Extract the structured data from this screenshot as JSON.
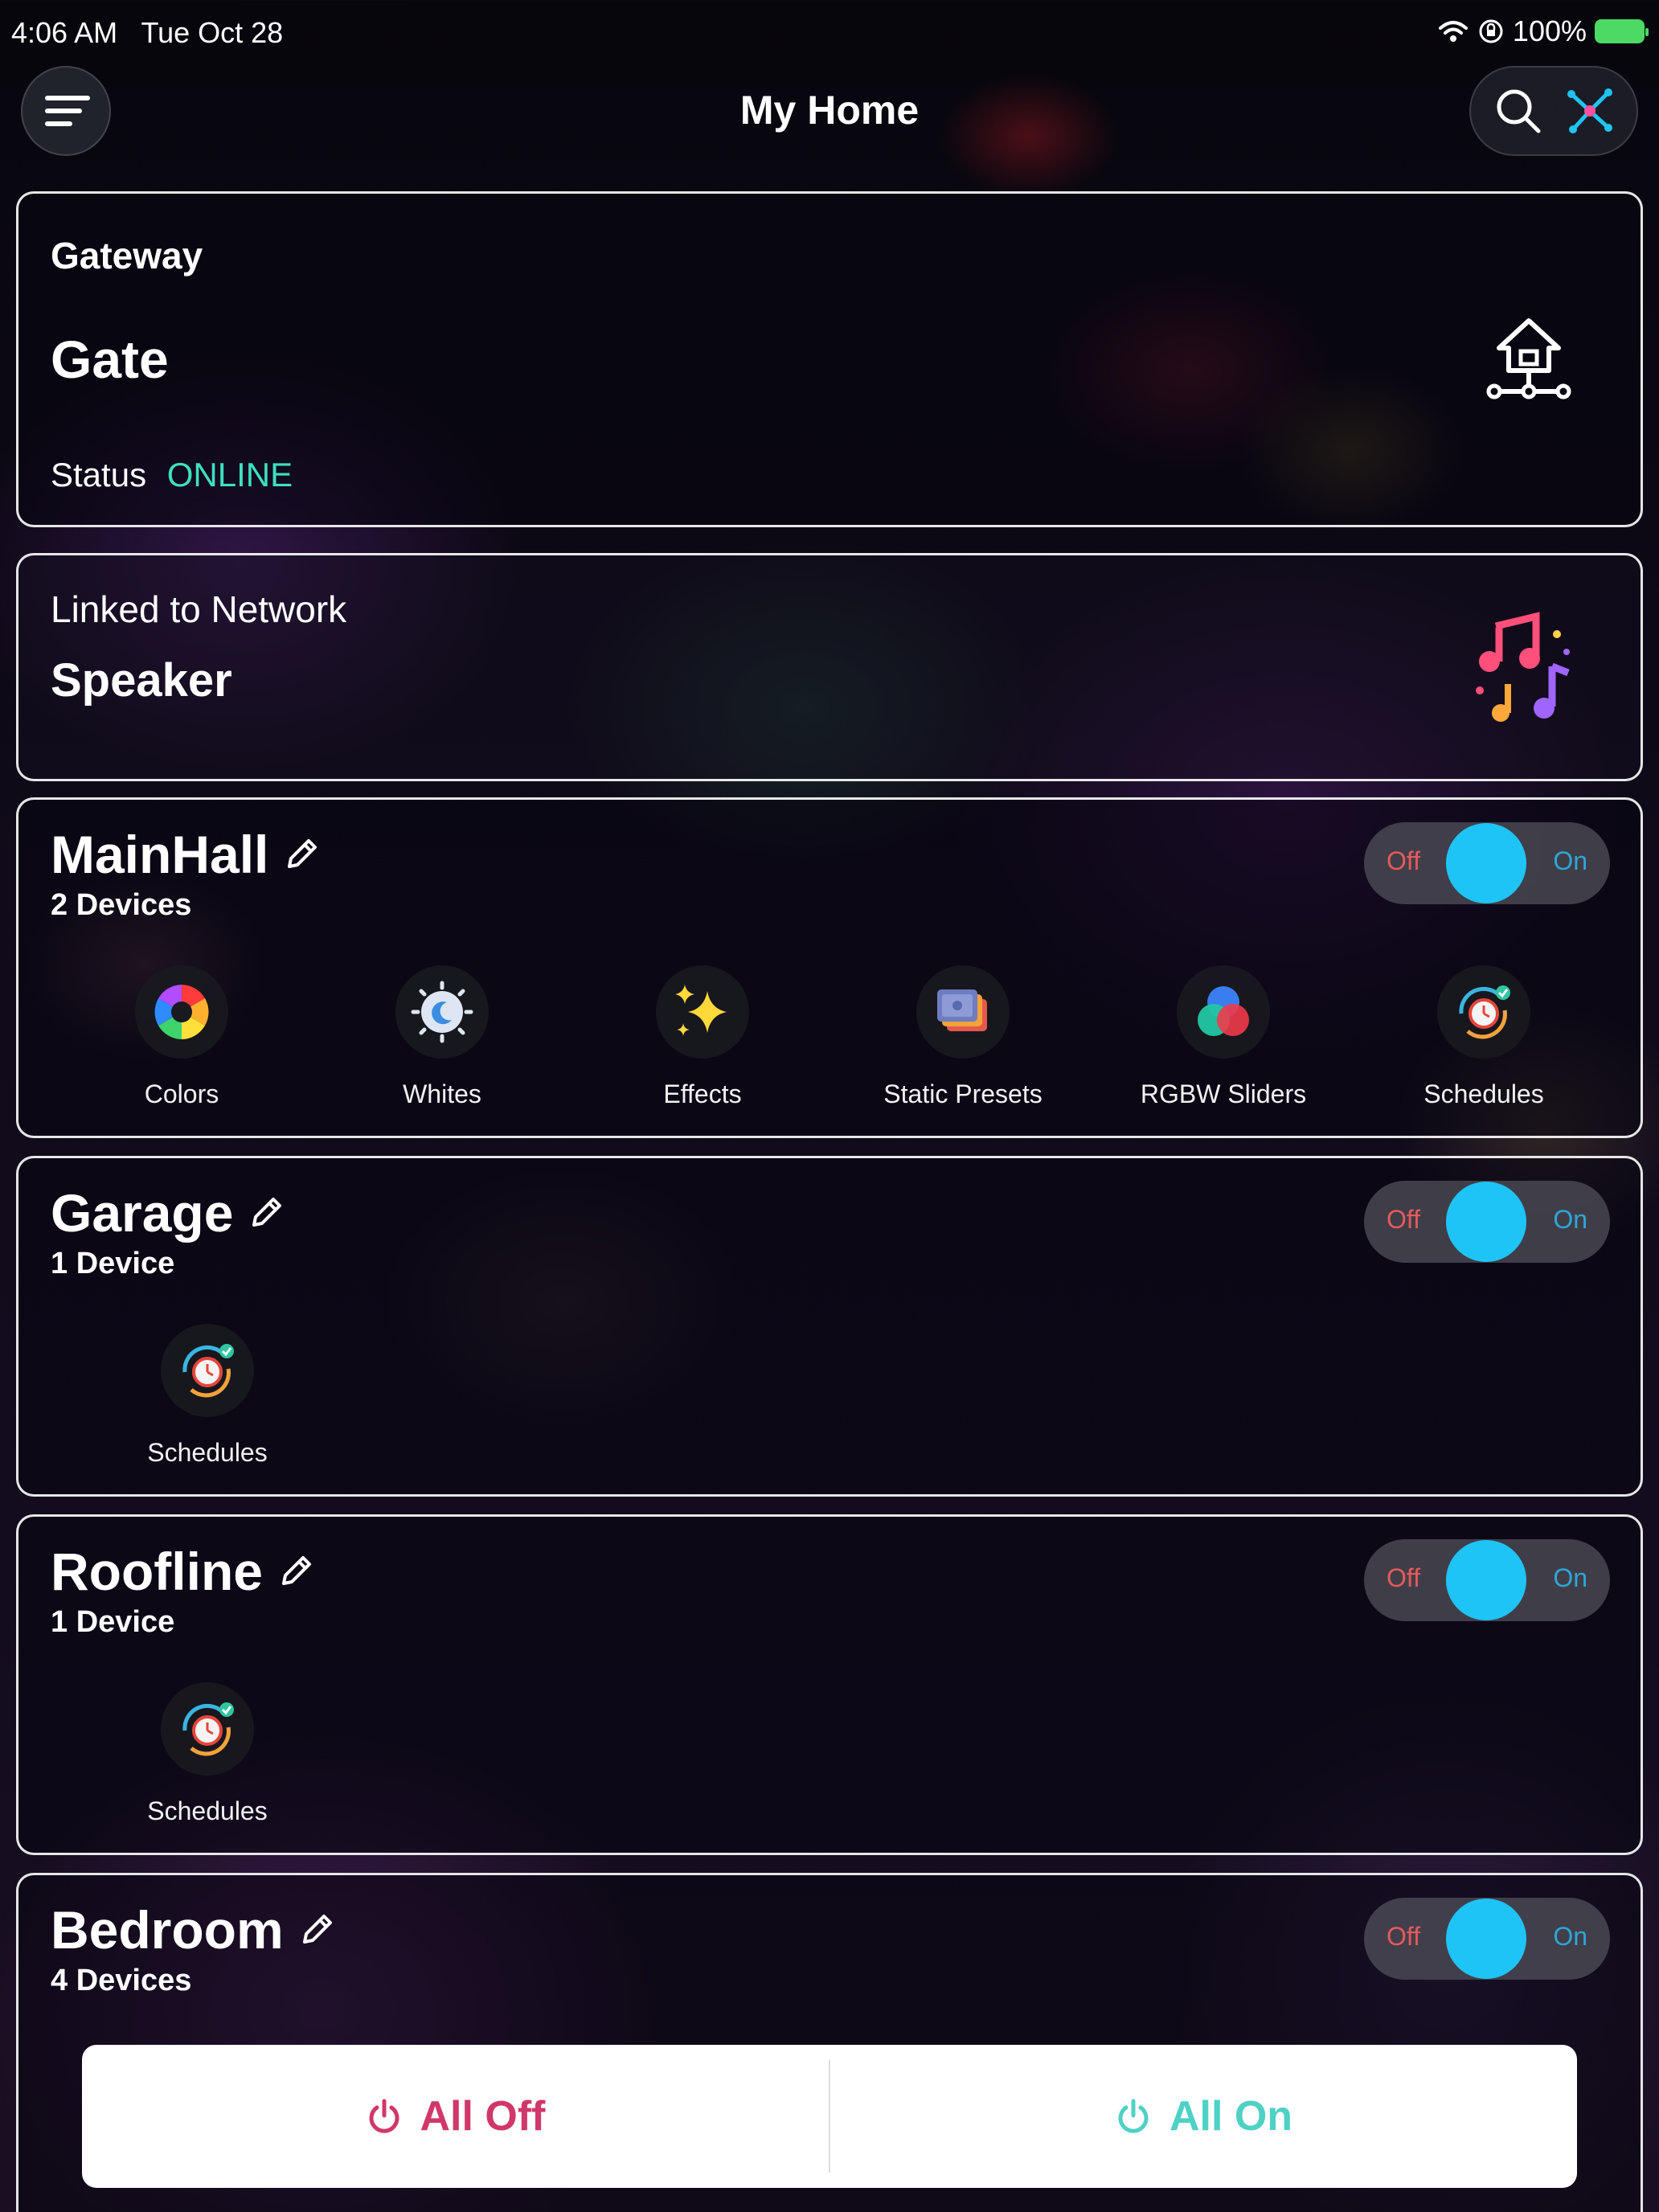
{
  "status_bar": {
    "time": "4:06 AM",
    "date": "Tue Oct 28",
    "battery": "100%"
  },
  "header": {
    "title": "My Home"
  },
  "gateway": {
    "label": "Gateway",
    "name": "Gate",
    "status_label": "Status",
    "status_value": "ONLINE"
  },
  "speaker": {
    "label": "Linked to Network",
    "name": "Speaker"
  },
  "rooms": [
    {
      "name": "MainHall",
      "count": "2 Devices",
      "off": "Off",
      "on": "On",
      "state": "on",
      "features": [
        "Colors",
        "Whites",
        "Effects",
        "Static Presets",
        "RGBW Sliders",
        "Schedules"
      ]
    },
    {
      "name": "Garage",
      "count": "1 Device",
      "off": "Off",
      "on": "On",
      "state": "on",
      "features": [
        "Schedules"
      ]
    },
    {
      "name": "Roofline",
      "count": "1 Device",
      "off": "Off",
      "on": "On",
      "state": "on",
      "features": [
        "Schedules"
      ]
    },
    {
      "name": "Bedroom",
      "count": "4 Devices",
      "off": "Off",
      "on": "On",
      "state": "on",
      "features": []
    }
  ],
  "bottom": {
    "all_off": "All Off",
    "all_on": "All On"
  },
  "colors": {
    "accent": "#1ec4f5",
    "online": "#3ee0c0",
    "off_red": "#d0386a",
    "on_teal": "#4fd1c5"
  },
  "icons": {
    "menu": "hamburger-icon",
    "search": "search-icon",
    "network": "network-icon",
    "gateway": "home-network-icon",
    "speaker": "music-notes-icon",
    "edit": "pencil-icon",
    "colors": "color-wheel-icon",
    "whites": "sun-moon-icon",
    "effects": "sparkles-icon",
    "static_presets": "presets-stack-icon",
    "rgbw": "rgb-circles-icon",
    "schedules": "timer-icon",
    "power": "power-icon"
  }
}
